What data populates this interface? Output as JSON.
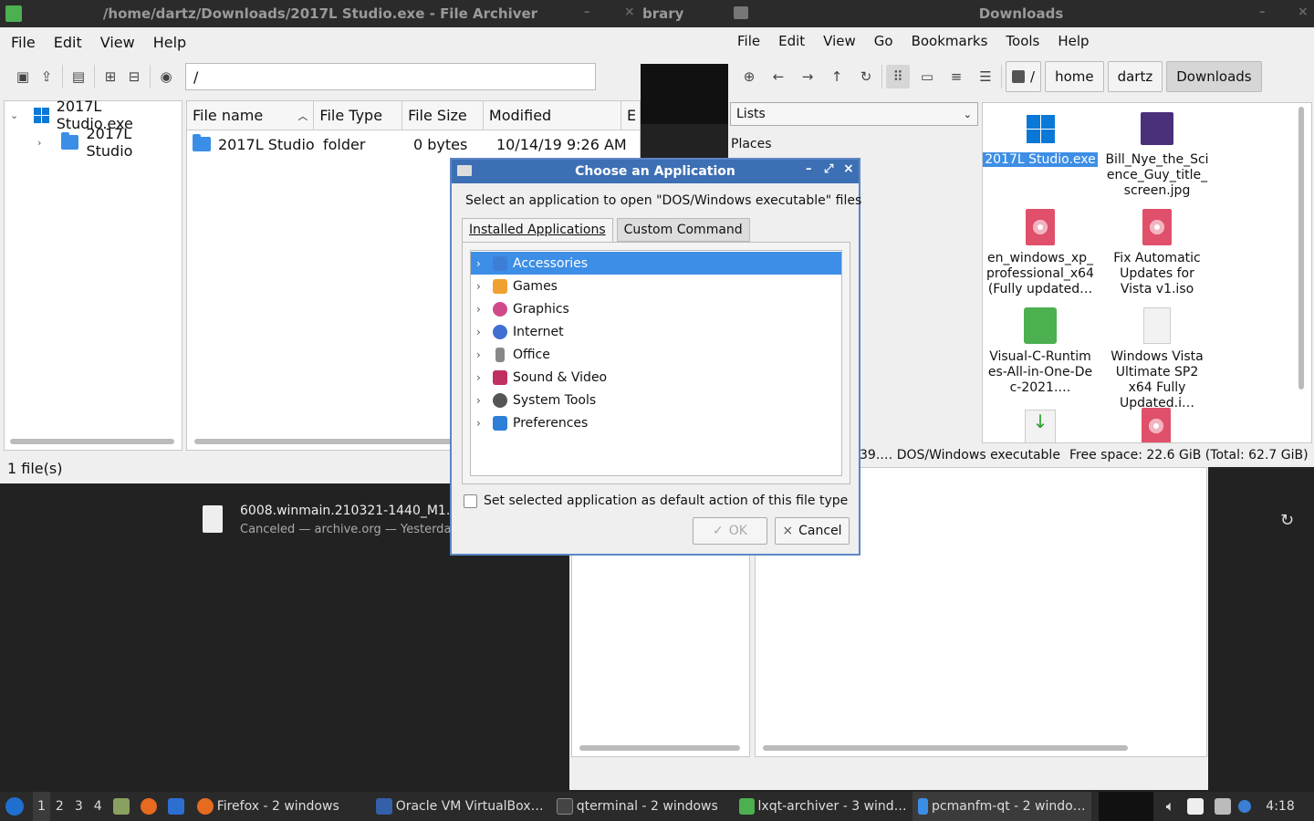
{
  "archiver": {
    "title": "/home/dartz/Downloads/2017L Studio.exe - File Archiver",
    "menu": [
      "File",
      "Edit",
      "View",
      "Help"
    ],
    "path": "/",
    "tree": {
      "root": "2017L Studio.exe",
      "child": "2017L Studio"
    },
    "columns": [
      "File name",
      "File Type",
      "File Size",
      "Modified",
      "E"
    ],
    "row": {
      "name": "2017L Studio",
      "type": "folder",
      "size": "0 bytes",
      "modified": "10/14/19 9:26 AM"
    },
    "status": "1 file(s)"
  },
  "other_window_title": "brary",
  "download": {
    "name": "6008.winmain.210321-1440_M1.is",
    "info": "Canceled — archive.org — Yesterday"
  },
  "fm": {
    "title": "Downloads",
    "menu": [
      "File",
      "Edit",
      "View",
      "Go",
      "Bookmarks",
      "Tools",
      "Help"
    ],
    "crumbs": [
      "/",
      "home",
      "dartz",
      "Downloads"
    ],
    "side_select": "Lists",
    "places": "Places",
    "files": [
      {
        "name": "2017L Studio.exe"
      },
      {
        "name": "Bill_Nye_the_Science_Guy_title_screen.jpg"
      },
      {
        "name": "en_windows_xp_professional_x64 (Fully updated…"
      },
      {
        "name": "Fix Automatic Updates for Vista v1.iso"
      },
      {
        "name": "Visual-C-Runtimes-All-in-One-Dec-2021.…"
      },
      {
        "name": "Windows Vista Ultimate SP2 x64 Fully Updated.i…"
      }
    ],
    "status_left": "39.… DOS/Windows executable",
    "status_right": "Free space: 22.6 GiB (Total: 62.7 GiB)"
  },
  "dialog": {
    "title": "Choose an Application",
    "prompt": "Select an application to open \"DOS/Windows executable\" files",
    "tabs": [
      "Installed Applications",
      "Custom Command"
    ],
    "categories": [
      {
        "label": "Accessories",
        "color": "#3d7fd6"
      },
      {
        "label": "Games",
        "color": "#f0a030"
      },
      {
        "label": "Graphics",
        "color": "#d04a8a"
      },
      {
        "label": "Internet",
        "color": "#3f6fd0"
      },
      {
        "label": "Office",
        "color": "#888888"
      },
      {
        "label": "Sound & Video",
        "color": "#c03060"
      },
      {
        "label": "System Tools",
        "color": "#555555"
      },
      {
        "label": "Preferences",
        "color": "#2d7fd8"
      }
    ],
    "checkbox_label": "Set selected application as default action of this file type",
    "ok": "OK",
    "cancel": "Cancel"
  },
  "taskbar": {
    "desktops": [
      "1",
      "2",
      "3",
      "4"
    ],
    "tasks": [
      "Firefox - 2 windows",
      "Oracle VM VirtualBox…",
      "qterminal - 2 windows",
      "lxqt-archiver - 3 wind…",
      "pcmanfm-qt - 2 windo…"
    ],
    "clock": "4:18"
  }
}
